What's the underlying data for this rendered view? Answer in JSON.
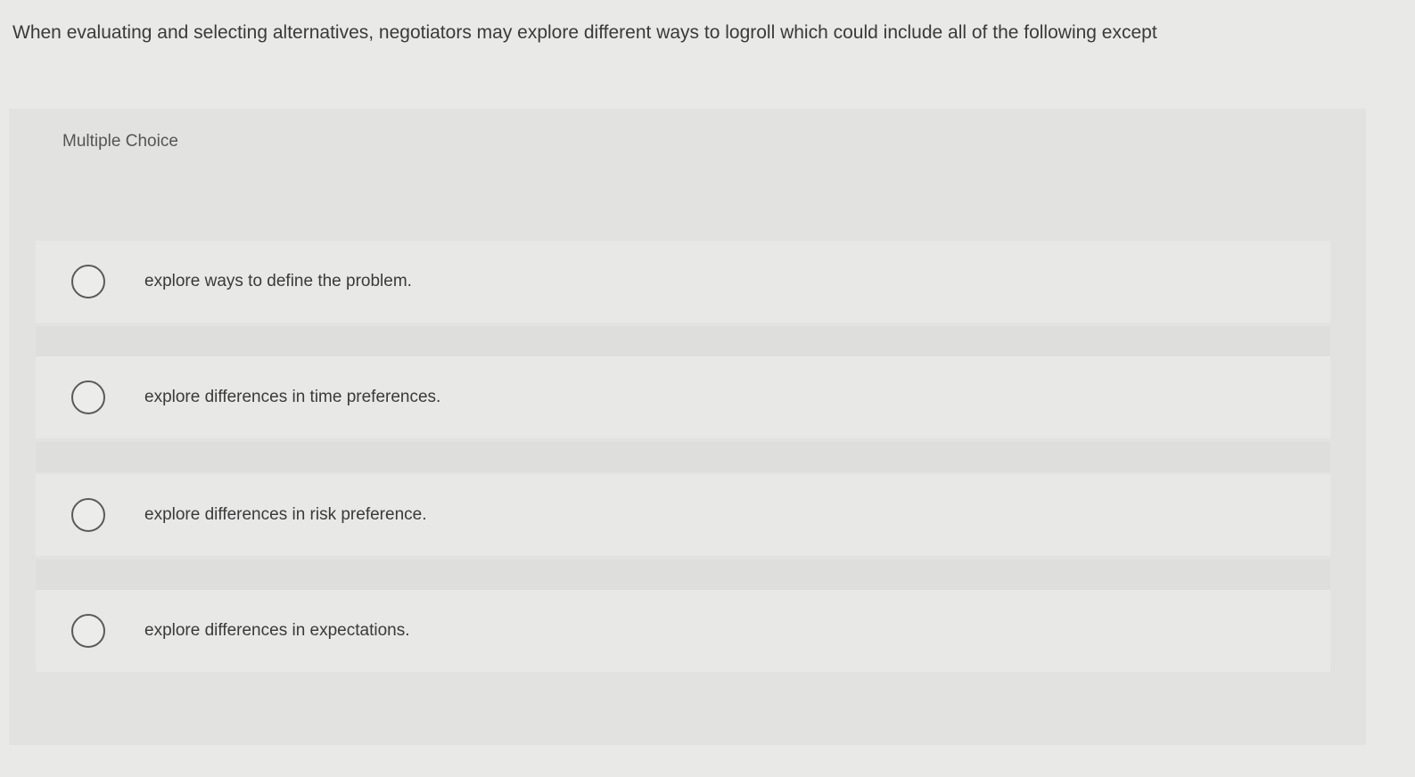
{
  "question": {
    "text": "When evaluating and selecting alternatives, negotiators may explore different ways to logroll which could include all of the following except"
  },
  "panel": {
    "header": "Multiple Choice",
    "options": [
      {
        "label": "explore ways to define the problem."
      },
      {
        "label": "explore differences in time preferences."
      },
      {
        "label": "explore differences in risk preference."
      },
      {
        "label": "explore differences in expectations."
      }
    ]
  },
  "colors": {
    "background": "#e9e9e7",
    "panel": "#e2e2e0",
    "radio_border": "#5a5a5a",
    "text": "#3a3a3a"
  }
}
